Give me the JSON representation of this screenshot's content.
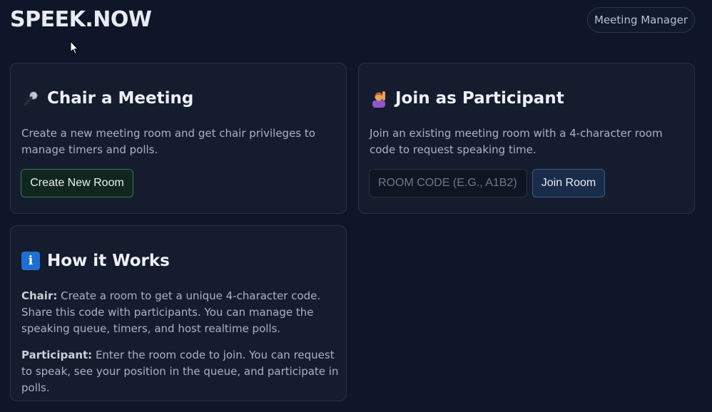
{
  "header": {
    "brand": "SPEEK.NOW",
    "manager_label": "Meeting Manager"
  },
  "chair_card": {
    "icon": "microphone-icon",
    "title": "Chair a Meeting",
    "description": "Create a new meeting room and get chair privileges to manage timers and polls.",
    "button_label": "Create New Room"
  },
  "join_card": {
    "icon": "raising-hand-icon",
    "title": "Join as Participant",
    "description": "Join an existing meeting room with a 4-character room code to request speaking time.",
    "input_placeholder": "ROOM CODE (E.G., A1B2)",
    "input_value": "",
    "button_label": "Join Room"
  },
  "how_card": {
    "icon": "info-icon",
    "icon_glyph": "i",
    "title": "How it Works",
    "chair_label": "Chair:",
    "chair_text": " Create a room to get a unique 4-character code. Share this code with participants. You can manage the speaking queue, timers, and host realtime polls.",
    "participant_label": "Participant:",
    "participant_text": " Enter the room code to join. You can request to speak, see your position in the queue, and participate in polls."
  },
  "colors": {
    "background": "#0f1629",
    "card": "#151c2e",
    "accent_green": "#2f7a58",
    "accent_blue": "#3b5d92",
    "info_blue": "#1f6fd1"
  }
}
